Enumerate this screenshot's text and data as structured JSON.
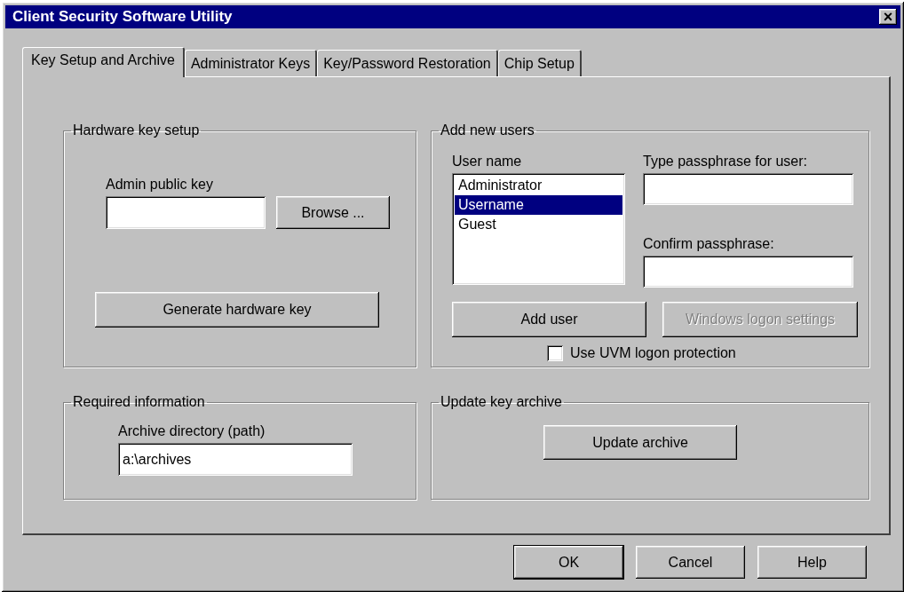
{
  "window": {
    "title": "Client Security Software Utility",
    "close": "×"
  },
  "tabs": [
    {
      "label": "Key Setup and Archive",
      "selected": true
    },
    {
      "label": "Administrator Keys",
      "selected": false
    },
    {
      "label": "Key/Password Restoration",
      "selected": false
    },
    {
      "label": "Chip Setup",
      "selected": false
    }
  ],
  "hardware_key_setup": {
    "title": "Hardware key setup",
    "field_label": "Admin public key",
    "browse_button": {
      "label": "Browse ...",
      "disabled": false
    },
    "generate_button": {
      "label": "Generate hardware key",
      "disabled": false
    }
  },
  "add_new_users": {
    "title": "Add new users",
    "list_label": "User name",
    "users": [
      {
        "name": "Administrator",
        "selected": false
      },
      {
        "name": "Username",
        "selected": true
      },
      {
        "name": "Guest",
        "selected": false
      }
    ],
    "passphrase_label": "Type passphrase for user:",
    "confirm_label": "Confirm passphrase:",
    "add_user_button": {
      "label": "Add user",
      "disabled": false
    },
    "windows_logon_button": {
      "label": "Windows logon settings",
      "disabled": true
    },
    "uvm_checkbox": {
      "label": "Use UVM logon protection",
      "checked": false
    }
  },
  "required_information": {
    "title": "Required information",
    "field_label": "Archive directory (path)",
    "value": "a:\\archives"
  },
  "update_key_archive": {
    "title": "Update key archive",
    "button": {
      "label": "Update archive",
      "disabled": false
    }
  },
  "buttons": [
    {
      "label": "OK",
      "default": true,
      "disabled": false
    },
    {
      "label": "Cancel",
      "default": false,
      "disabled": false
    },
    {
      "label": "Help",
      "default": false,
      "disabled": false
    }
  ]
}
